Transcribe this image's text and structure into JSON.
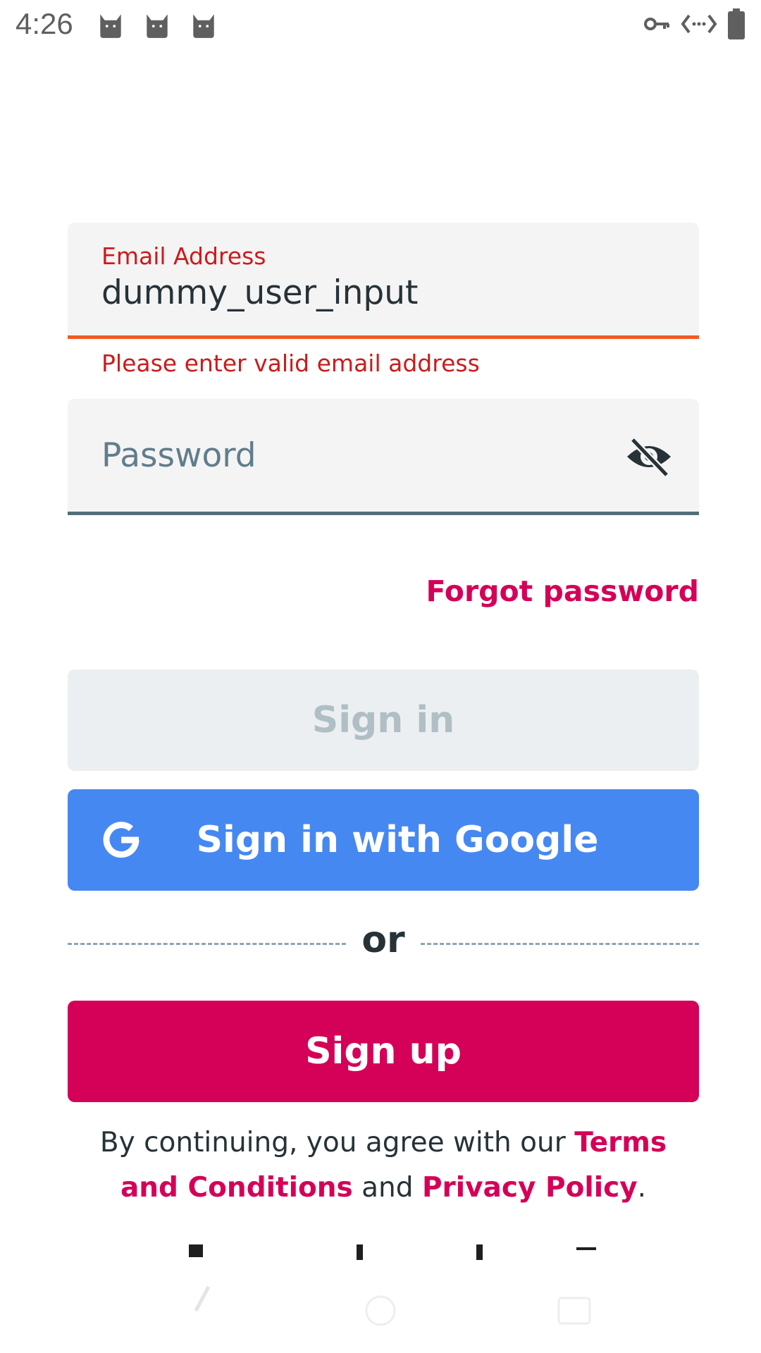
{
  "status_bar": {
    "time": "4:26",
    "notification_icons": [
      "cat-icon",
      "cat-icon",
      "cat-icon"
    ],
    "system_icons": [
      "vpn-key-icon",
      "data-signal-icon",
      "battery-icon"
    ]
  },
  "login": {
    "email": {
      "label": "Email Address",
      "value": "dummy_user_input",
      "error": "Please enter valid email address"
    },
    "password": {
      "placeholder": "Password",
      "value": "",
      "toggle_icon": "eye-off-icon"
    },
    "forgot_password": "Forgot password",
    "sign_in_label": "Sign in",
    "google_label": "Sign in with Google",
    "divider_label": "or",
    "sign_up_label": "Sign up",
    "legal": {
      "prefix": "By continuing, you agree with our ",
      "terms_link": "Terms and Conditions",
      "middle": " and ",
      "privacy_link": "Privacy Policy",
      "suffix": "."
    }
  },
  "colors": {
    "accent": "#d50057",
    "google_blue": "#4688f1",
    "error": "#cc1b1b",
    "error_underline": "#f15a24",
    "disabled_bg": "#eceff1",
    "disabled_text": "#b0bec5"
  }
}
